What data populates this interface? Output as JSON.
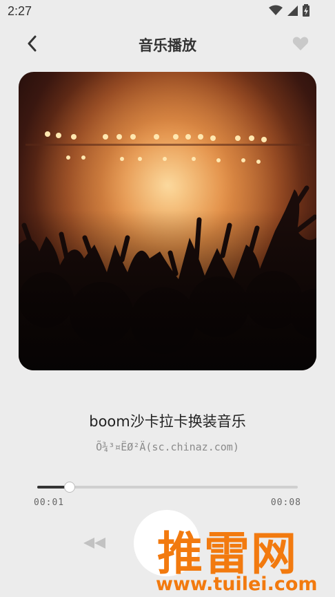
{
  "status_bar": {
    "time": "2:27",
    "icons": [
      "wifi-icon",
      "signal-icon",
      "battery-icon"
    ]
  },
  "header": {
    "title": "音乐播放",
    "back_icon": "chevron-left-icon",
    "favorite_icon": "heart-icon"
  },
  "track": {
    "title": "boom沙卡拉卡换装音乐",
    "artist": "Õ¾³¤ËØ²Ä(sc.chinaz.com)"
  },
  "progress": {
    "current": "00:01",
    "total": "00:08",
    "fraction": 0.125
  },
  "controls": {
    "prev_icon": "rewind-icon",
    "play_icon": "play-button"
  },
  "watermark": {
    "brand": "推雷网",
    "url": "www.tuilei.com"
  },
  "colors": {
    "background": "#ececec",
    "accent": "#f27a0f",
    "progress_fill": "#333333"
  }
}
